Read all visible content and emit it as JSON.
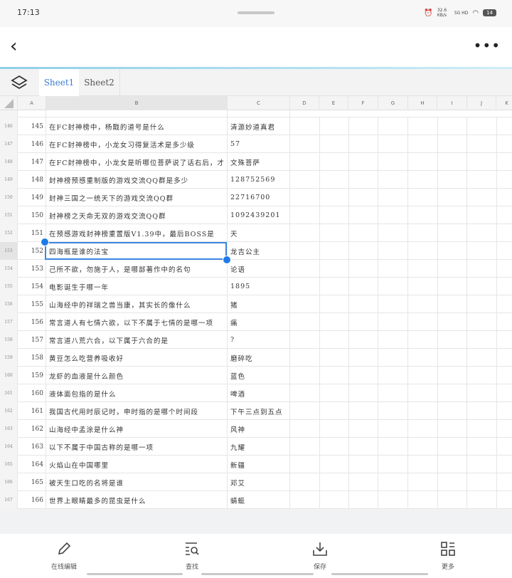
{
  "status": {
    "time": "17:13",
    "speed": "32.6 KB/s",
    "network": "5G HD",
    "battery": "14"
  },
  "tabs": [
    "Sheet1",
    "Sheet2"
  ],
  "columns": [
    "A",
    "B",
    "C",
    "D",
    "E",
    "F",
    "G",
    "H",
    "I",
    "J",
    "K"
  ],
  "rows": [
    {
      "rn": "146",
      "a": "145",
      "b": "在FC封神榜中，杨戬的道号是什么",
      "c": "清源妙道真君"
    },
    {
      "rn": "147",
      "a": "146",
      "b": "在FC封神榜中，小龙女习得复活术是多少级",
      "c": "57"
    },
    {
      "rn": "148",
      "a": "147",
      "b": "在FC封神榜中，小龙女是听哪位菩萨说了话右后，才",
      "c": "文殊菩萨"
    },
    {
      "rn": "149",
      "a": "148",
      "b": "封神榜预感重制版的游戏交流QQ群是多少",
      "c": "128752569"
    },
    {
      "rn": "150",
      "a": "149",
      "b": "封神三国之一统天下的游戏交流QQ群",
      "c": "22716700"
    },
    {
      "rn": "151",
      "a": "150",
      "b": "封神榜之天命无双的游戏交流QQ群",
      "c": "1092439201"
    },
    {
      "rn": "152",
      "a": "151",
      "b": "在预感游戏封神榜重置版V1.39中，最后BOSS是",
      "c": "天"
    },
    {
      "rn": "153",
      "a": "152",
      "b": "四海瓶是谁的法宝",
      "c": "龙吉公主"
    },
    {
      "rn": "154",
      "a": "153",
      "b": "己所不欲，勿施于人，是哪部著作中的名句",
      "c": "论语"
    },
    {
      "rn": "155",
      "a": "154",
      "b": "电影诞生于哪一年",
      "c": "1895"
    },
    {
      "rn": "156",
      "a": "155",
      "b": "山海经中的祥瑞之兽当康，其实长的像什么",
      "c": "猪"
    },
    {
      "rn": "157",
      "a": "156",
      "b": "常言道人有七情六欲，以下不属于七情的是哪一项",
      "c": "痛"
    },
    {
      "rn": "158",
      "a": "157",
      "b": "常言道八荒六合，以下属于六合的是",
      "c": "?"
    },
    {
      "rn": "159",
      "a": "158",
      "b": "黄豆怎么吃营养吸收好",
      "c": "磨碎吃"
    },
    {
      "rn": "160",
      "a": "159",
      "b": "龙虾的血液是什么颜色",
      "c": "蓝色"
    },
    {
      "rn": "161",
      "a": "160",
      "b": "液体面包指的是什么",
      "c": "啤酒"
    },
    {
      "rn": "162",
      "a": "161",
      "b": "我国古代用时辰记时，申时指的是哪个时间段",
      "c": "下午三点到五点"
    },
    {
      "rn": "163",
      "a": "162",
      "b": "山海经中孟涂是什么神",
      "c": "风神"
    },
    {
      "rn": "164",
      "a": "163",
      "b": "以下不属于中国古称的是哪一项",
      "c": "九耀"
    },
    {
      "rn": "165",
      "a": "164",
      "b": "火焰山在中国哪里",
      "c": "新疆"
    },
    {
      "rn": "166",
      "a": "165",
      "b": "被天生口吃的名将是谁",
      "c": "邓艾"
    },
    {
      "rn": "167",
      "a": "166",
      "b": "世界上眼睛最多的昆虫是什么",
      "c": "蜻蜓"
    }
  ],
  "bottom": {
    "edit": "在线编辑",
    "find": "查找",
    "save": "保存",
    "more": "更多"
  },
  "accent": "#3b86e0"
}
